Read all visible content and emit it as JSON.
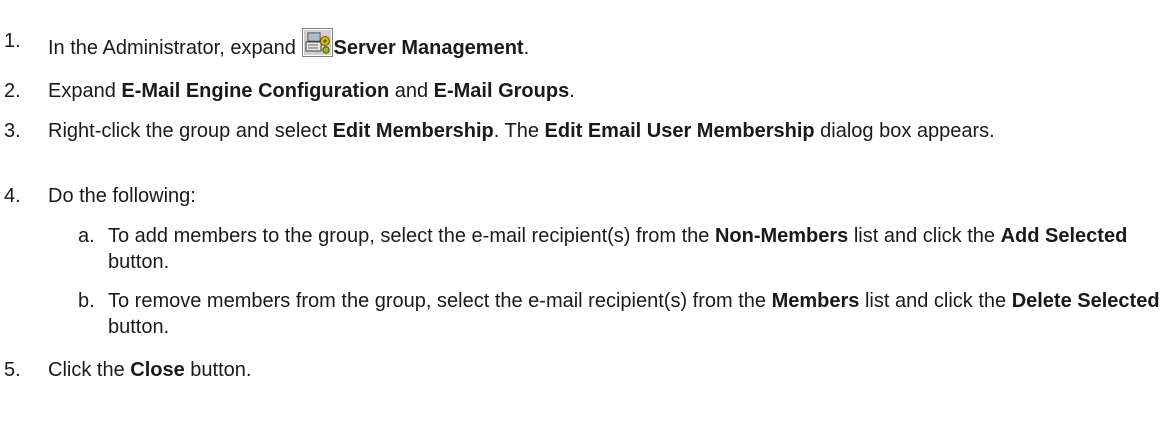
{
  "steps": [
    {
      "number": "1.",
      "prefix": "In the Administrator, expand ",
      "bold": "Server Management",
      "suffix": ".",
      "icon": "server-management-icon"
    },
    {
      "number": "2.",
      "p1": "Expand ",
      "b1": "E-Mail Engine Configuration",
      "p2": " and ",
      "b2": "E-Mail Groups",
      "p3": "."
    },
    {
      "number": "3.",
      "p1": "Right-click the group and select ",
      "b1": "Edit Membership",
      "p2": ". The ",
      "b2": "Edit Email User Membership",
      "p3": " dialog box appears."
    },
    {
      "number": "4.",
      "text": "Do the following:",
      "substeps": [
        {
          "letter": "a.",
          "p1": "To add members to the group, select the e-mail recipient(s) from the ",
          "b1": "Non-Members",
          "p2": " list and click the ",
          "b2": "Add Selected",
          "p3": " button."
        },
        {
          "letter": "b.",
          "p1": "To remove members from the group, select the e-mail recipient(s) from the ",
          "b1": "Members",
          "p2": " list and click the ",
          "b2": "Delete Selected",
          "p3": " button."
        }
      ]
    },
    {
      "number": "5.",
      "p1": "Click the ",
      "b1": "Close",
      "p2": " button."
    }
  ]
}
